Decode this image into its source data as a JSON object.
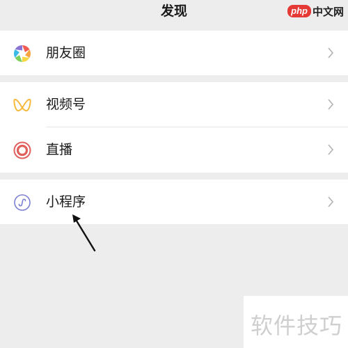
{
  "header": {
    "title": "发现"
  },
  "watermark_top": {
    "badge": "php",
    "text": "中文网"
  },
  "menu": {
    "moments": {
      "label": "朋友圈",
      "icon": "moments-aperture-icon"
    },
    "channels": {
      "label": "视频号",
      "icon": "channels-butterfly-icon"
    },
    "live": {
      "label": "直播",
      "icon": "live-ring-icon"
    },
    "mini_programs": {
      "label": "小程序",
      "icon": "mini-program-icon"
    }
  },
  "watermark_bottom": {
    "text": "软件技巧"
  },
  "colors": {
    "background": "#ededed",
    "row": "#ffffff",
    "text": "#191919",
    "chevron": "#b2b2b2",
    "live_icon": "#e0605e",
    "channels_icon": "#f5b93b",
    "mini_program_icon": "#7b7fd1"
  }
}
